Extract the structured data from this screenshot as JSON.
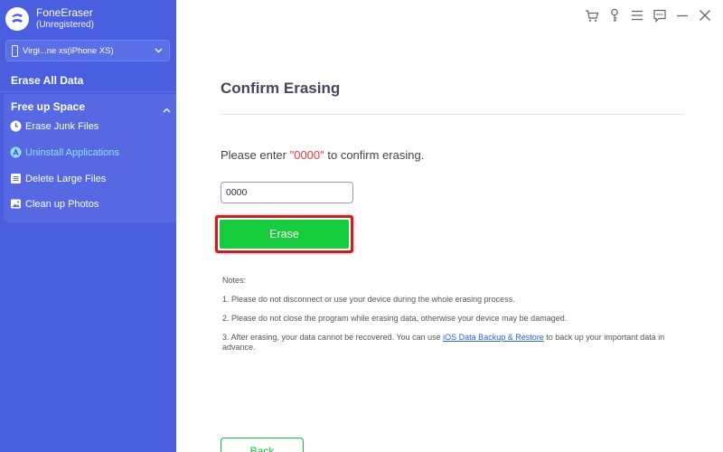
{
  "brand": {
    "name": "FoneEraser",
    "status": "(Unregistered)"
  },
  "device": {
    "name": "Virgi...ne xs(iPhone XS)"
  },
  "sidebar": {
    "erase_all": "Erase All Data",
    "free_up": {
      "title": "Free up Space",
      "items": [
        {
          "label": "Erase Junk Files",
          "icon": "clock-icon",
          "active": false
        },
        {
          "label": "Uninstall Applications",
          "icon": "app-store-icon",
          "active": true
        },
        {
          "label": "Delete Large Files",
          "icon": "document-icon",
          "active": false
        },
        {
          "label": "Clean up Photos",
          "icon": "image-icon",
          "active": false
        }
      ]
    }
  },
  "topbar": {
    "icons": [
      "cart-icon",
      "key-icon",
      "menu-icon",
      "chat-icon",
      "minimize-icon",
      "close-icon"
    ]
  },
  "main": {
    "title": "Confirm Erasing",
    "prompt": {
      "before": "Please enter ",
      "code": "\"0000\"",
      "after": " to confirm erasing."
    },
    "input_value": "0000",
    "erase_label": "Erase",
    "notes": {
      "heading": "Notes:",
      "n1": "1. Please do not disconnect or use your device during the whole erasing process.",
      "n2": "2. Please do not close the program while erasing data, otherwise your device may be damaged.",
      "n3_before": "3. After erasing, your data cannot be recovered. You can use ",
      "n3_link": "iOS Data Backup & Restore",
      "n3_after": " to back up your important data in advance."
    },
    "back_label": "Back"
  },
  "colors": {
    "sidebar_bg": "#4a5fe0",
    "erase_green": "#17cc3c",
    "highlight_red": "#b8252b",
    "code_red": "#e43c3c",
    "link_blue": "#2463d8",
    "active_cyan": "#8fe0ff"
  }
}
